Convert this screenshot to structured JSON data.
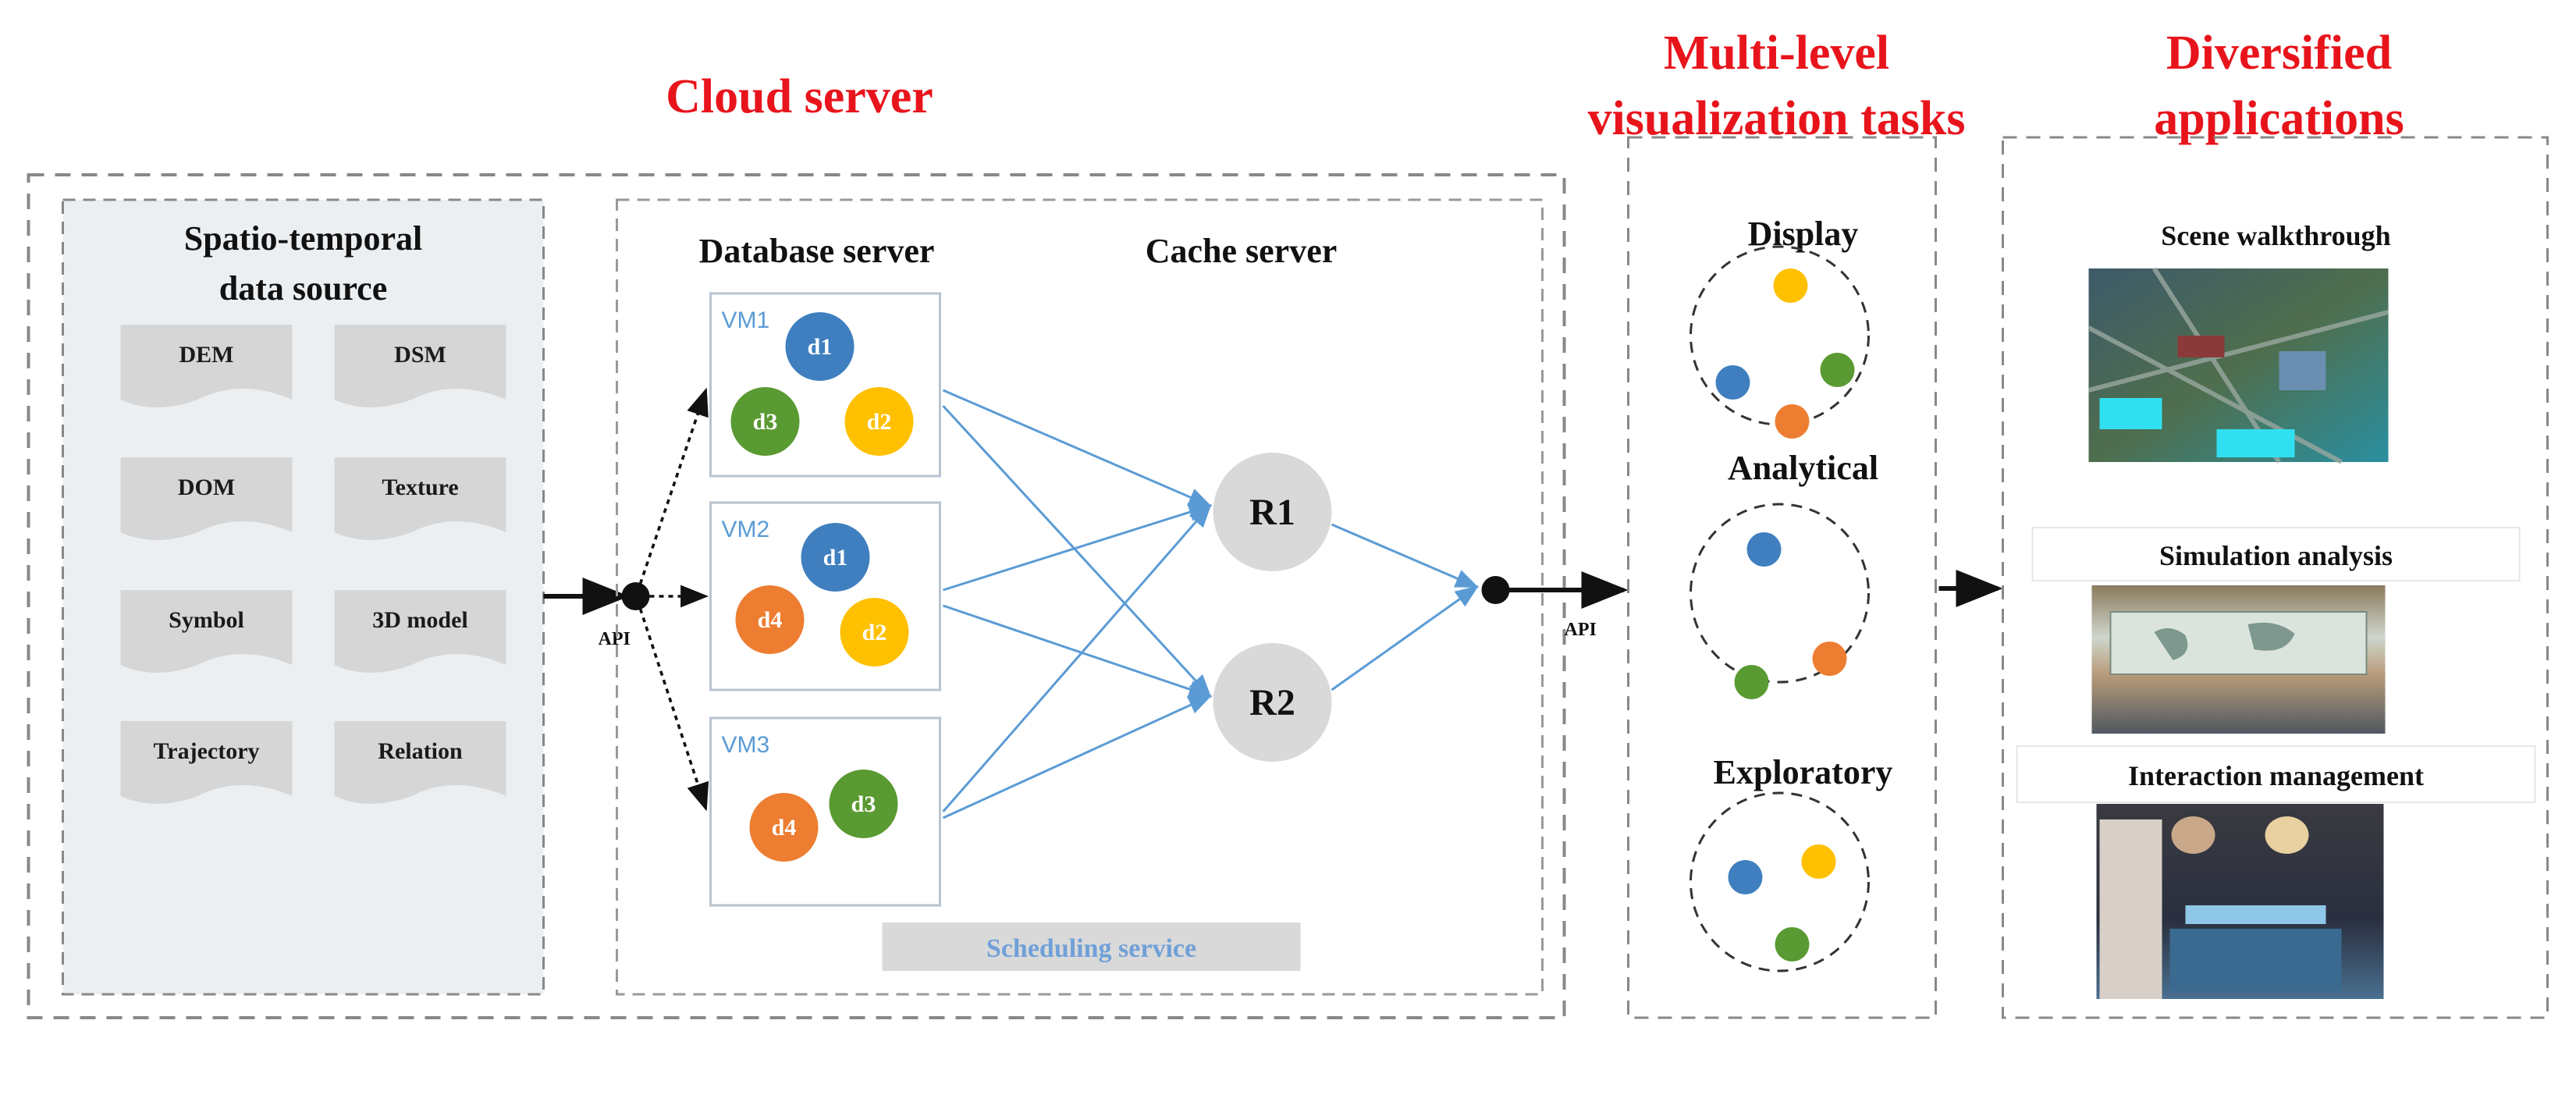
{
  "titles": {
    "cloud_server": "Cloud server",
    "multi_level_1": "Multi-level",
    "multi_level_2": "visualization tasks",
    "diversified_1": "Diversified",
    "diversified_2": "applications"
  },
  "data_source": {
    "title_1": "Spatio-temporal",
    "title_2": "data source",
    "items": [
      "DEM",
      "DSM",
      "DOM",
      "Texture",
      "Symbol",
      "3D model",
      "Trajectory",
      "Relation"
    ]
  },
  "server": {
    "database_label": "Database server",
    "cache_label": "Cache server",
    "vms": [
      {
        "label": "VM1",
        "data": [
          "d1",
          "d3",
          "d2"
        ]
      },
      {
        "label": "VM2",
        "data": [
          "d1",
          "d4",
          "d2"
        ]
      },
      {
        "label": "VM3",
        "data": [
          "d4",
          "d3"
        ]
      }
    ],
    "caches": [
      "R1",
      "R2"
    ],
    "scheduling": "Scheduling service",
    "api_in": "API",
    "api_out": "API"
  },
  "tasks": [
    "Display",
    "Analytical",
    "Exploratory"
  ],
  "applications": [
    "Scene walkthrough",
    "Simulation analysis",
    "Interaction management"
  ],
  "colors": {
    "title_red": "#e8141c",
    "d1": "#3f7fbf",
    "d2": "#ffc000",
    "d3": "#5a9a32",
    "d4": "#ed7d31",
    "vm_blue": "#5b9bd5",
    "arrow_blue": "#5b9bd5",
    "cache_gray": "#d9d9d9"
  }
}
